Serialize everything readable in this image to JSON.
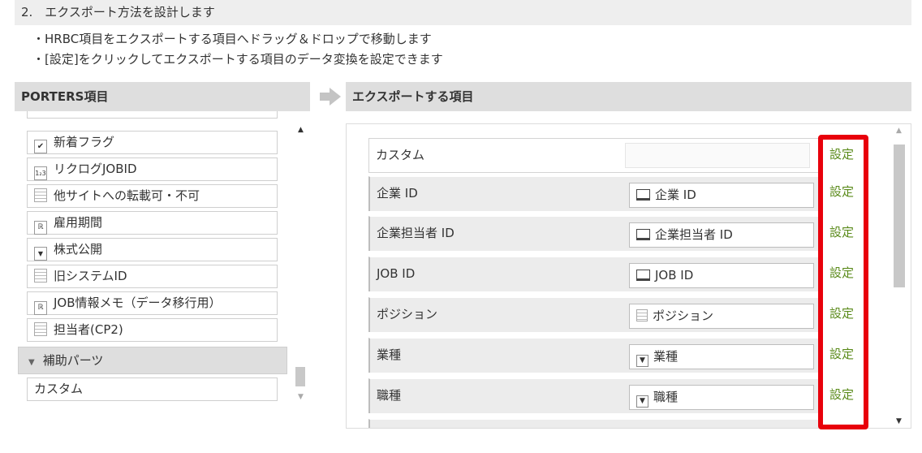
{
  "step": {
    "title": "2.　エクスポート方法を設計します"
  },
  "notes": [
    "・HRBC項目をエクスポートする項目へドラッグ＆ドロップで移動します",
    "・[設定]をクリックしてエクスポートする項目のデータ変換を設定できます"
  ],
  "left_panel": {
    "header": "PORTERS項目",
    "items": [
      {
        "icon": "checkbox-icon",
        "label": "新着フラグ"
      },
      {
        "icon": "number-icon",
        "label": "リクログJOBID"
      },
      {
        "icon": "text-doc-icon",
        "label": "他サイトへの転載可・不可"
      },
      {
        "icon": "richtext-icon",
        "label": "雇用期間"
      },
      {
        "icon": "dropdown-icon",
        "label": "株式公開"
      },
      {
        "icon": "text-doc-icon",
        "label": "旧システムID"
      },
      {
        "icon": "richtext-icon",
        "label": "JOB情報メモ（データ移行用）"
      },
      {
        "icon": "text-doc-icon",
        "label": "担当者(CP2)"
      }
    ],
    "group": {
      "label": "補助パーツ"
    },
    "group_items": [
      {
        "label": "カスタム"
      }
    ]
  },
  "right_panel": {
    "header": "エクスポートする項目",
    "rows": [
      {
        "label": "カスタム",
        "value": "",
        "icon": "",
        "setting": "設定"
      },
      {
        "label": "企業 ID",
        "value": "企業 ID",
        "icon": "monitor-icon",
        "setting": "設定"
      },
      {
        "label": "企業担当者 ID",
        "value": "企業担当者 ID",
        "icon": "monitor-icon",
        "setting": "設定"
      },
      {
        "label": "JOB ID",
        "value": "JOB ID",
        "icon": "monitor-icon",
        "setting": "設定"
      },
      {
        "label": "ポジション",
        "value": "ポジション",
        "icon": "text-doc-icon",
        "setting": "設定"
      },
      {
        "label": "業種",
        "value": "業種",
        "icon": "dropdown-icon",
        "setting": "設定"
      },
      {
        "label": "職種",
        "value": "職種",
        "icon": "dropdown-icon",
        "setting": "設定"
      }
    ]
  },
  "colors": {
    "highlight": "#e8000b",
    "setting_link": "#5a8a1a",
    "header_bg": "#dedede"
  }
}
